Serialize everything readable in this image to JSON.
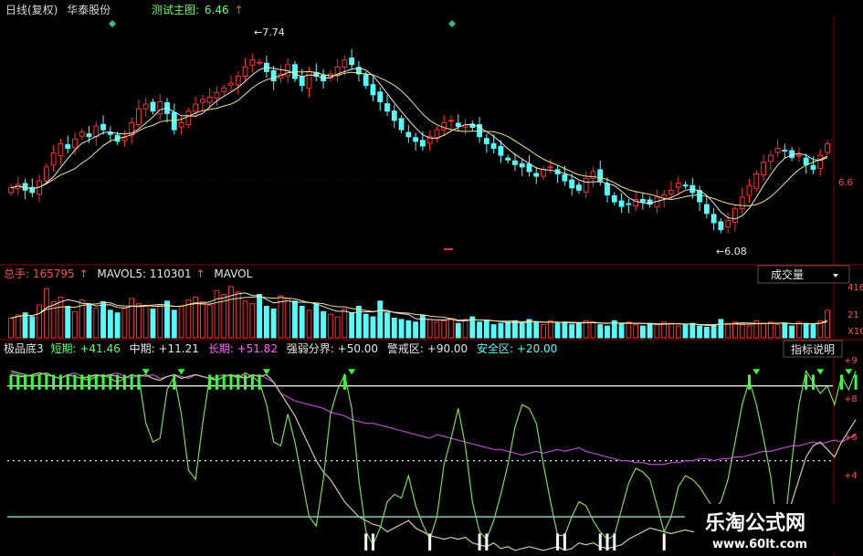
{
  "header": {
    "period": "日线(复权)",
    "stock": "华泰股份",
    "indicator_label": "测试主图:",
    "indicator_value": "6.46",
    "up_arrow": "↑"
  },
  "price_panel": {
    "high_label": "7.74",
    "low_label": "6.08",
    "axis_label": "6.6"
  },
  "volume_panel": {
    "total_label": "总手: ",
    "total_value": "165795",
    "mavol5_label": "MAVOL5: ",
    "mavol5_value": "110301",
    "mavol_label": "MAVOL",
    "dropdown": "成交量",
    "axis_labels": [
      "416",
      "21",
      "X10"
    ]
  },
  "indicator_panel": {
    "name": "极品底3",
    "short_label": "短期: ",
    "short_value": "+41.46",
    "mid_label": "中期: ",
    "mid_value": "+11.21",
    "long_label": "长期: ",
    "long_value": "+51.82",
    "strength_label": "强弱分界: ",
    "strength_value": "+50.00",
    "warning_label": "警戒区: ",
    "warning_value": "+90.00",
    "safe_label": "安全区: ",
    "safe_value": "+20.00",
    "help_button": "指标说明",
    "axis_labels": [
      "+9",
      "+8",
      "+6",
      "+4"
    ]
  },
  "watermark": {
    "name": "乐淘公式网",
    "url": "www.60lt.com"
  },
  "colors": {
    "up": "#ff3030",
    "down": "#54ffff",
    "ma_white": "#e8e8e8",
    "ma_yellow": "#f0e68c",
    "short_line": "#7dd957",
    "mid_line": "#d5c9a0",
    "long_line": "#b44cc8",
    "signal_green": "#3cff3c",
    "label_green": "#66ff66",
    "label_red": "#ff5050",
    "label_magenta": "#ff66ff",
    "panel_border": "#8b0000",
    "safe_line": "#8fdcdc"
  },
  "chart_data": [
    {
      "type": "candlestick",
      "title": "测试主图",
      "ylim": [
        6.0,
        7.9
      ],
      "marked_high": 7.74,
      "marked_low": 6.08,
      "close": [
        6.52,
        6.55,
        6.5,
        6.48,
        6.58,
        6.7,
        6.82,
        6.9,
        6.86,
        6.94,
        7.0,
        6.96,
        7.05,
        7.02,
        6.98,
        6.92,
        6.95,
        7.08,
        7.2,
        7.24,
        7.18,
        7.26,
        7.16,
        7.02,
        7.08,
        7.18,
        7.24,
        7.28,
        7.3,
        7.34,
        7.38,
        7.42,
        7.48,
        7.56,
        7.62,
        7.6,
        7.52,
        7.44,
        7.5,
        7.58,
        7.46,
        7.4,
        7.52,
        7.48,
        7.44,
        7.5,
        7.56,
        7.62,
        7.58,
        7.5,
        7.4,
        7.32,
        7.26,
        7.18,
        7.1,
        7.02,
        6.96,
        6.92,
        6.88,
        6.96,
        7.02,
        7.08,
        7.1,
        7.05,
        7.06,
        7.04,
        6.96,
        6.9,
        6.86,
        6.8,
        6.76,
        6.72,
        6.7,
        6.66,
        6.62,
        6.68,
        6.7,
        6.64,
        6.58,
        6.52,
        6.5,
        6.6,
        6.66,
        6.58,
        6.46,
        6.4,
        6.36,
        6.38,
        6.42,
        6.4,
        6.38,
        6.44,
        6.46,
        6.5,
        6.56,
        6.54,
        6.48,
        6.4,
        6.3,
        6.22,
        6.16,
        6.24,
        6.34,
        6.44,
        6.54,
        6.64,
        6.74,
        6.8,
        6.86,
        6.84,
        6.78,
        6.8,
        6.72,
        6.68,
        6.8,
        6.9
      ]
    },
    {
      "type": "bar",
      "title": "成交量",
      "values": [
        30,
        35,
        38,
        32,
        50,
        75,
        55,
        62,
        48,
        40,
        58,
        52,
        45,
        55,
        42,
        38,
        46,
        60,
        52,
        48,
        44,
        50,
        56,
        42,
        48,
        58,
        62,
        55,
        50,
        72,
        66,
        78,
        70,
        56,
        52,
        66,
        48,
        44,
        64,
        60,
        56,
        48,
        42,
        52,
        40,
        36,
        32,
        44,
        38,
        48,
        36,
        32,
        56,
        38,
        30,
        28,
        26,
        24,
        34,
        28,
        24,
        26,
        30,
        22,
        28,
        32,
        24,
        26,
        20,
        22,
        24,
        26,
        22,
        28,
        24,
        20,
        26,
        22,
        24,
        20,
        22,
        26,
        24,
        20,
        18,
        26,
        22,
        24,
        20,
        18,
        22,
        20,
        24,
        22,
        18,
        20,
        22,
        18,
        16,
        20,
        28,
        22,
        24,
        20,
        18,
        26,
        22,
        24,
        20,
        22,
        18,
        24,
        22,
        20,
        26,
        42
      ]
    },
    {
      "type": "line",
      "title": "极品底3",
      "ylim": [
        0,
        105
      ],
      "reference_lines": [
        90,
        50,
        20
      ],
      "series": [
        {
          "name": "短期",
          "values": [
            98,
            97,
            96,
            95,
            96,
            97,
            95,
            94,
            96,
            95,
            94,
            93,
            95,
            96,
            94,
            92,
            94,
            96,
            95,
            70,
            60,
            62,
            88,
            95,
            75,
            45,
            40,
            70,
            95,
            93,
            95,
            96,
            94,
            97,
            95,
            92,
            80,
            60,
            58,
            75,
            60,
            40,
            20,
            15,
            40,
            75,
            88,
            96,
            78,
            40,
            12,
            5,
            14,
            28,
            32,
            30,
            42,
            26,
            16,
            8,
            20,
            48,
            62,
            78,
            58,
            28,
            12,
            8,
            18,
            32,
            48,
            68,
            80,
            78,
            70,
            48,
            28,
            10,
            10,
            20,
            28,
            26,
            18,
            12,
            8,
            10,
            24,
            38,
            46,
            44,
            40,
            26,
            12,
            20,
            36,
            42,
            40,
            36,
            30,
            24,
            28,
            40,
            60,
            80,
            93,
            80,
            62,
            42,
            12,
            16,
            50,
            80,
            98,
            92,
            86,
            90,
            80,
            95,
            88,
            98
          ]
        },
        {
          "name": "中期",
          "values": [
            96,
            95,
            95,
            96,
            97,
            96,
            95,
            94,
            96,
            95,
            94,
            95,
            96,
            95,
            96,
            95,
            94,
            96,
            95,
            96,
            94,
            93,
            95,
            96,
            94,
            95,
            96,
            95,
            94,
            93,
            95,
            96,
            95,
            94,
            96,
            95,
            96,
            92,
            86,
            80,
            74,
            66,
            58,
            50,
            44,
            40,
            34,
            28,
            24,
            20,
            18,
            16,
            15,
            12,
            14,
            16,
            18,
            14,
            12,
            10,
            9,
            8,
            9,
            8,
            9,
            6,
            5,
            4,
            6,
            3,
            4,
            2,
            3,
            4,
            3,
            2,
            3,
            4,
            2,
            3,
            6,
            5,
            6,
            4,
            3,
            4,
            5,
            8,
            10,
            12,
            14,
            13,
            12,
            11,
            12,
            13,
            12,
            12,
            14,
            16,
            15,
            18,
            20,
            22,
            24,
            14,
            10,
            8,
            10,
            14,
            28,
            40,
            52,
            58,
            60,
            56,
            52,
            60,
            66,
            72
          ]
        },
        {
          "name": "长期",
          "values": [
            97,
            96,
            95,
            96,
            97,
            96,
            95,
            94,
            96,
            97,
            95,
            94,
            96,
            95,
            96,
            97,
            95,
            94,
            96,
            95,
            96,
            94,
            95,
            96,
            95,
            94,
            96,
            95,
            94,
            95,
            96,
            95,
            96,
            94,
            95,
            96,
            94,
            92,
            86,
            84,
            82,
            81,
            80,
            79,
            78,
            76,
            75,
            74,
            72,
            71,
            70,
            70,
            69,
            68,
            67,
            66,
            65,
            64,
            63,
            62,
            64,
            63,
            62,
            61,
            60,
            59,
            58,
            57,
            56,
            56,
            55,
            54,
            53,
            54,
            55,
            54,
            55,
            56,
            55,
            56,
            57,
            55,
            54,
            53,
            52,
            51,
            50,
            50,
            49,
            49,
            48,
            48,
            48,
            49,
            49,
            50,
            50,
            51,
            51,
            50,
            51,
            51,
            52,
            52,
            53,
            54,
            55,
            55,
            56,
            57,
            58,
            58,
            59,
            60,
            59,
            60,
            61,
            60,
            62,
            64
          ]
        }
      ]
    }
  ]
}
